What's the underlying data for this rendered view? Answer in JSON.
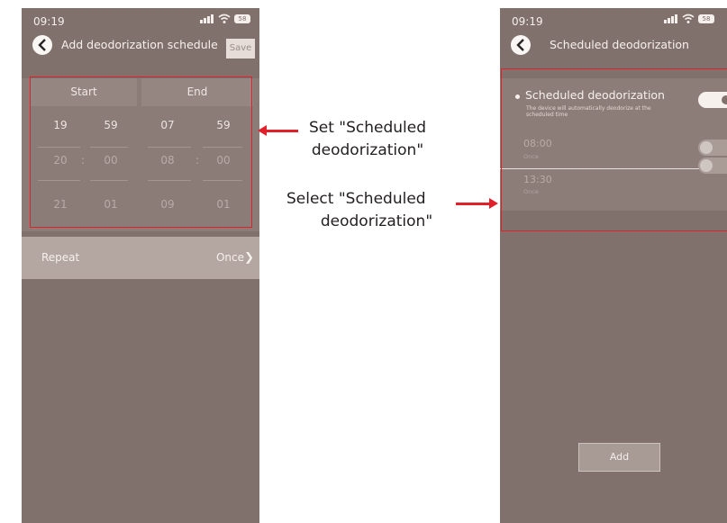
{
  "left_screen": {
    "status_time": "09:19",
    "battery": "58",
    "title": "Add deodorization schedule",
    "save_label": "Save",
    "picker": {
      "start_label": "Start",
      "end_label": "End",
      "rows": [
        [
          "19",
          "59",
          "07",
          "59"
        ],
        [
          "20",
          "00",
          "08",
          "00"
        ],
        [
          "21",
          "01",
          "09",
          "01"
        ]
      ],
      "colon": ":"
    },
    "repeat_label": "Repeat",
    "repeat_value": "Once"
  },
  "right_screen": {
    "status_time": "09:19",
    "battery": "58",
    "title": "Scheduled deodorization",
    "main_title": "Scheduled deodorization",
    "main_desc": "The device will automatically deodorize at the scheduled time",
    "main_toggle_on": true,
    "items": [
      {
        "time": "08:00",
        "repeat": "Once",
        "enabled": false
      },
      {
        "time": "13:30",
        "repeat": "Once",
        "enabled": false
      }
    ],
    "add_label": "Add"
  },
  "annotations": {
    "set_line1": "Set \"Scheduled",
    "set_line2": "deodorization\"",
    "select_line1": "Select  \"Scheduled",
    "select_line2": "deodorization\""
  },
  "colors": {
    "highlight": "#e0202a",
    "screen_bg": "#81716c"
  }
}
